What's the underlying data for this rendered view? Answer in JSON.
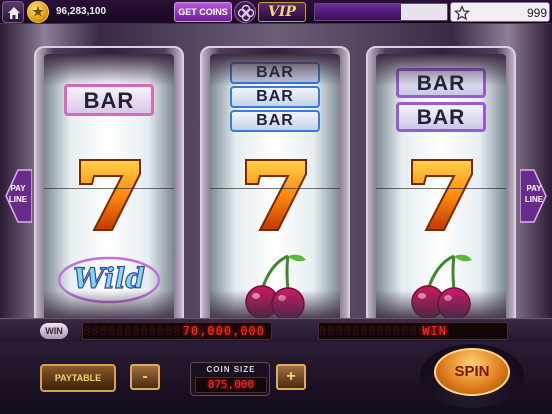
{
  "topbar": {
    "balance": "96,283,100",
    "get_coins_label": "GET COINS",
    "vip_label": "VIP",
    "xp_progress": 0.65,
    "star_count": "999"
  },
  "reels": [
    {
      "symbols": [
        "BAR",
        "7",
        "Wild"
      ]
    },
    {
      "symbols": [
        "BAR",
        "BAR",
        "BAR",
        "7",
        "cherry"
      ]
    },
    {
      "symbols": [
        "BAR",
        "BAR",
        "7",
        "cherry"
      ]
    }
  ],
  "payline": {
    "label_line1": "PAY",
    "label_line2": "LINE"
  },
  "meters": {
    "win_label": "WIN",
    "total_win_value": "70,000,000",
    "status_value": "WIN"
  },
  "controls": {
    "paytable_label": "PAYTABLE",
    "minus_label": "-",
    "plus_label": "+",
    "coin_size_label": "COIN SIZE",
    "coin_size_value": "875,000",
    "spin_label": "SPIN"
  },
  "colors": {
    "accent_purple": "#6a1f8f",
    "led_red": "#ff2a1a",
    "gold": "#e0a010"
  }
}
